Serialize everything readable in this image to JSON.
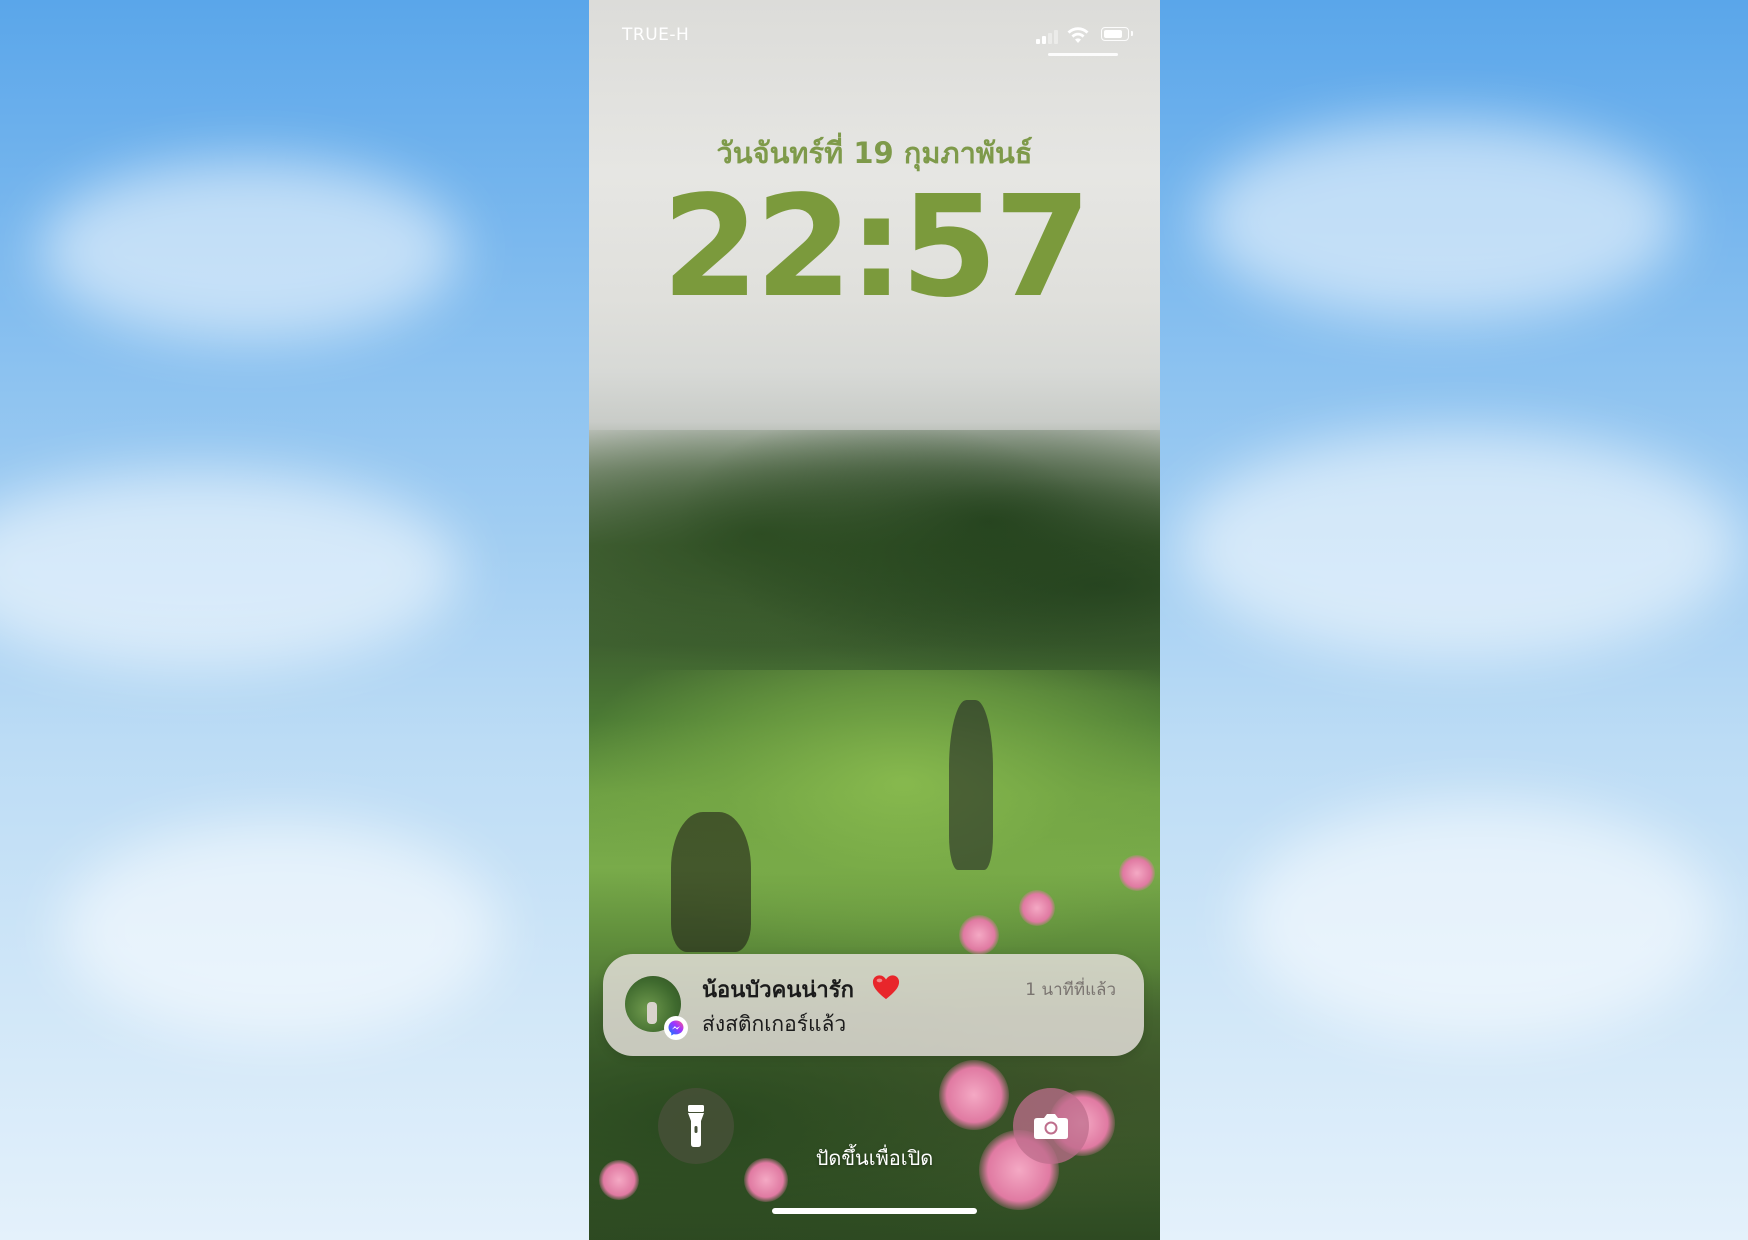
{
  "status_bar": {
    "carrier": "TRUE-H",
    "signal_icon": "signal-bars-icon",
    "signal_bars_active": 2,
    "wifi_icon": "wifi-icon",
    "battery_icon": "battery-icon",
    "battery_level": 0.85
  },
  "lock_screen": {
    "date": "วันจันทร์ที่ 19 กุมภาพันธ์",
    "time": "22:57",
    "accent_color": "#7b9a3c"
  },
  "notification": {
    "sender": "น้อนบัวคนน่ารัก",
    "heart_icon": "red-heart-icon",
    "message": "ส่งสติกเกอร์แล้ว",
    "time": "1 นาทีที่แล้ว",
    "app_icon": "messenger-icon"
  },
  "quick_actions": {
    "flashlight_icon": "flashlight-icon",
    "camera_icon": "camera-icon"
  },
  "swipe_hint": "ปัดขึ้นเพื่อเปิด"
}
